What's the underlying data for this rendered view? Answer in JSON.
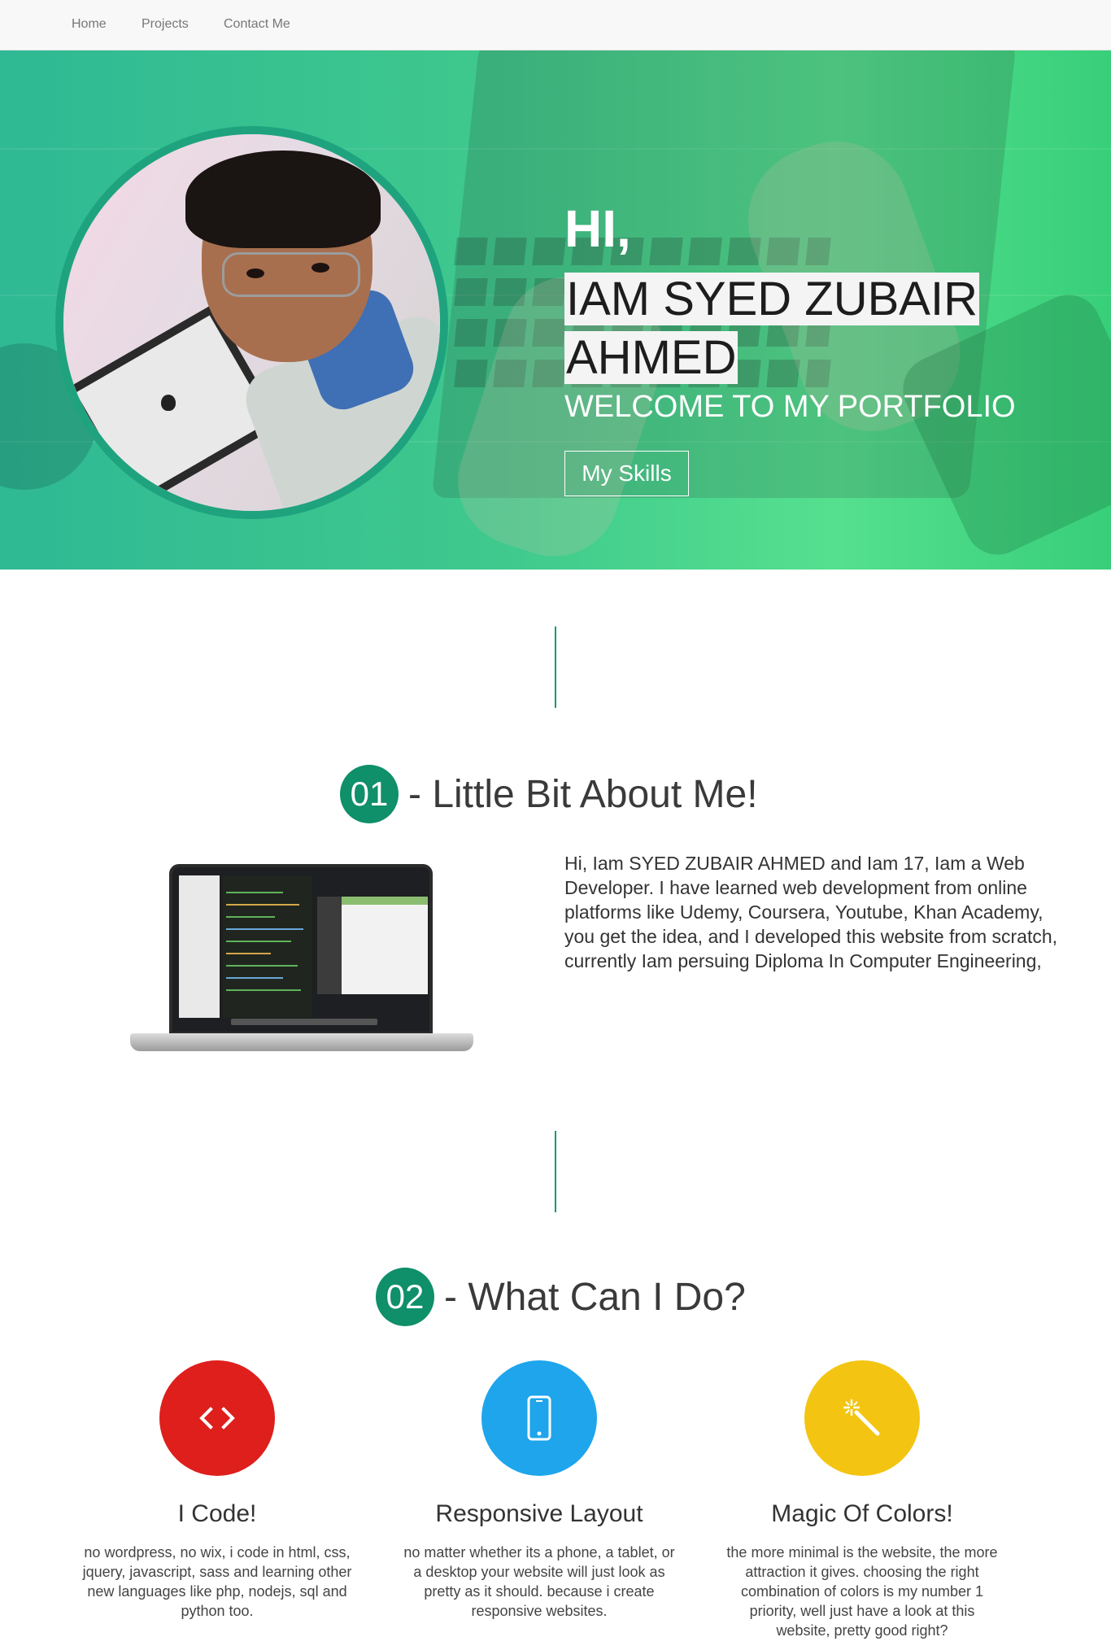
{
  "nav": {
    "items": [
      "Home",
      "Projects",
      "Contact Me"
    ]
  },
  "hero": {
    "greeting": "HI,",
    "name": "IAM SYED ZUBAIR AHMED",
    "subtitle": "WELCOME TO MY PORTFOLIO",
    "button_label": "My Skills"
  },
  "about": {
    "number": "01",
    "title": "- Little Bit About Me!",
    "text": "Hi, Iam SYED ZUBAIR AHMED and Iam 17, Iam a Web Developer. I have learned web development from online platforms like Udemy, Coursera, Youtube, Khan Academy, you get the idea, and I developed this website from scratch, currently Iam persuing Diploma In Computer Engineering,"
  },
  "services": {
    "number": "02",
    "title": "- What Can I Do?",
    "items": [
      {
        "title": "I Code!",
        "icon": "code-icon",
        "color": "#de1f1c",
        "description": "no wordpress, no wix, i code in html, css, jquery, javascript, sass and learning other new languages like php, nodejs, sql and python too."
      },
      {
        "title": "Responsive Layout",
        "icon": "mobile-icon",
        "color": "#1ea5ec",
        "description": "no matter whether its a phone, a tablet, or a desktop your website will just look as pretty as it should. because i create responsive websites."
      },
      {
        "title": "Magic Of Colors!",
        "icon": "magic-wand-icon",
        "color": "#f3c512",
        "description": "the more minimal is the website, the more attraction it gives. choosing the right combination of colors is my number 1 priority, well just have a look at this website, pretty good right?"
      }
    ]
  },
  "colors": {
    "accent": "#0f8f6a",
    "hero_gradient_start": "#2fb994",
    "hero_gradient_end": "#55e08f"
  }
}
